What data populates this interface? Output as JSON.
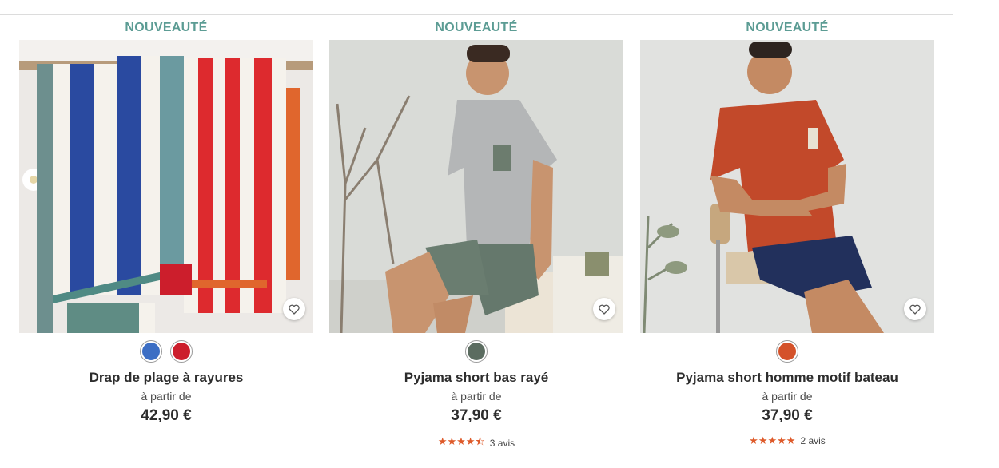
{
  "products": [
    {
      "badge": "NOUVEAUTÉ",
      "name": "Drap de plage à rayures",
      "from_label": "à partir de",
      "price": "42,90 €",
      "colors": [
        "#3c6ec4",
        "#cc1e2c"
      ],
      "image": "striped-beach-towels-photo"
    },
    {
      "badge": "NOUVEAUTÉ",
      "name": "Pyjama short bas rayé",
      "from_label": "à partir de",
      "price": "37,90 €",
      "colors": [
        "#5b6c60"
      ],
      "rating": 4.5,
      "stars": "★★★★⯪",
      "reviews": "3 avis",
      "image": "man-grey-pyjama-photo"
    },
    {
      "badge": "NOUVEAUTÉ",
      "name": "Pyjama short homme motif bateau",
      "from_label": "à partir de",
      "price": "37,90 €",
      "colors": [
        "#d4522a"
      ],
      "rating": 5,
      "stars": "★★★★★",
      "reviews": "2 avis",
      "image": "man-orange-pyjama-photo"
    }
  ],
  "icons": {
    "favorite": "heart-icon"
  },
  "colors": {
    "badge": "#5c9c94",
    "star": "#de5a2a",
    "text": "#2d2d2d"
  }
}
